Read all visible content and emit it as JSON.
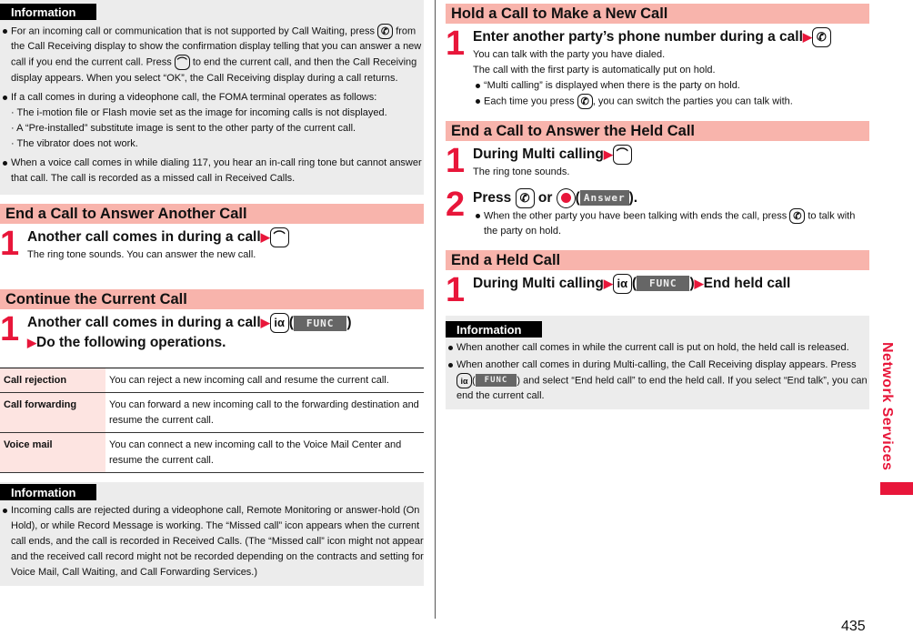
{
  "left": {
    "info1": {
      "tag": "Information",
      "b1": {
        "t1": "For an incoming call or communication that is not supported by Call Waiting, press",
        "t2": "from the Call Receiving display to show the confirmation display telling that you can answer a new call if you end the current call. Press",
        "t3": "to end the current call, and then the Call Receiving display appears. When you select “OK”, the Call Receiving display during a call returns."
      },
      "b2": {
        "t": "If a call comes in during a videophone call, the FOMA terminal operates as follows:",
        "subs": [
          "The i-motion file or Flash movie set as the image for incoming calls is not displayed.",
          "A “Pre-installed” substitute image is sent to the other party of the current call.",
          "The vibrator does not work."
        ]
      },
      "b3": "When a voice call comes in while dialing 117, you hear an in-call ring tone but cannot answer that call. The call is recorded as a missed call in Received Calls."
    },
    "sec1": {
      "title": "End a Call to Answer Another Call",
      "step1": {
        "num": "1",
        "title": "Another call comes in during a call",
        "body": "The ring tone sounds. You can answer the new call."
      }
    },
    "sec2": {
      "title": "Continue the Current Call",
      "step1": {
        "num": "1",
        "title": "Another call comes in during a call",
        "soft": "FUNC",
        "title2": "Do the following operations."
      },
      "table": [
        {
          "key": "Call rejection",
          "desc": "You can reject a new incoming call and resume the current call."
        },
        {
          "key": "Call forwarding",
          "desc": "You can forward a new incoming call to the forwarding destination and resume the current call."
        },
        {
          "key": "Voice mail",
          "desc": "You can connect a new incoming call to the Voice Mail Center and resume the current call."
        }
      ]
    },
    "info2": {
      "tag": "Information",
      "b1": "Incoming calls are rejected during a videophone call, Remote Monitoring or answer-hold (On Hold), or while Record Message is working. The “Missed call” icon appears when the current call ends, and the call is recorded in Received Calls. (The “Missed call” icon might not appear and the received call record might not be recorded depending on the contracts and setting for Voice Mail, Call Waiting, and Call Forwarding Services.)"
    }
  },
  "right": {
    "sec1": {
      "title": "Hold a Call to Make a New Call",
      "step1": {
        "num": "1",
        "title": "Enter another party’s phone number during a call",
        "body1": "You can talk with the party you have dialed.",
        "body2": "The call with the first party is automatically put on hold.",
        "b1": "“Multi calling” is displayed when there is the party on hold.",
        "b2a": "Each time you press",
        "b2b": ", you can switch the parties you can talk with."
      }
    },
    "sec2": {
      "title": "End a Call to Answer the Held Call",
      "step1": {
        "num": "1",
        "title": "During Multi calling",
        "body": "The ring tone sounds."
      },
      "step2": {
        "num": "2",
        "title_a": "Press",
        "title_b": "or",
        "soft": "Answer",
        "title_c": ").",
        "b1a": "When the other party you have been talking with ends the call, press",
        "b1b": "to talk with the party on hold."
      }
    },
    "sec3": {
      "title": "End a Held Call",
      "step1": {
        "num": "1",
        "title": "During Multi calling",
        "soft": "FUNC",
        "title2": "End held call"
      }
    },
    "info": {
      "tag": "Information",
      "b1": "When another call comes in while the current call is put on hold, the held call is released.",
      "b2a": "When another call comes in during Multi-calling, the Call Receiving display appears. Press",
      "soft": "FUNC",
      "b2b": ") and select “End held call” to end the held call. If you select “End talk”, you can end the current call."
    }
  },
  "sidebar": {
    "label": "Network Services"
  },
  "page_number": "435",
  "icons": {
    "call_key": "✆",
    "end_key": "⌒",
    "ialpha_key": "iα"
  },
  "colors": {
    "accent": "#e8163a",
    "section_bg": "#f8b4ac",
    "info_bg": "#ececec",
    "table_key_bg": "#fde4e1"
  }
}
